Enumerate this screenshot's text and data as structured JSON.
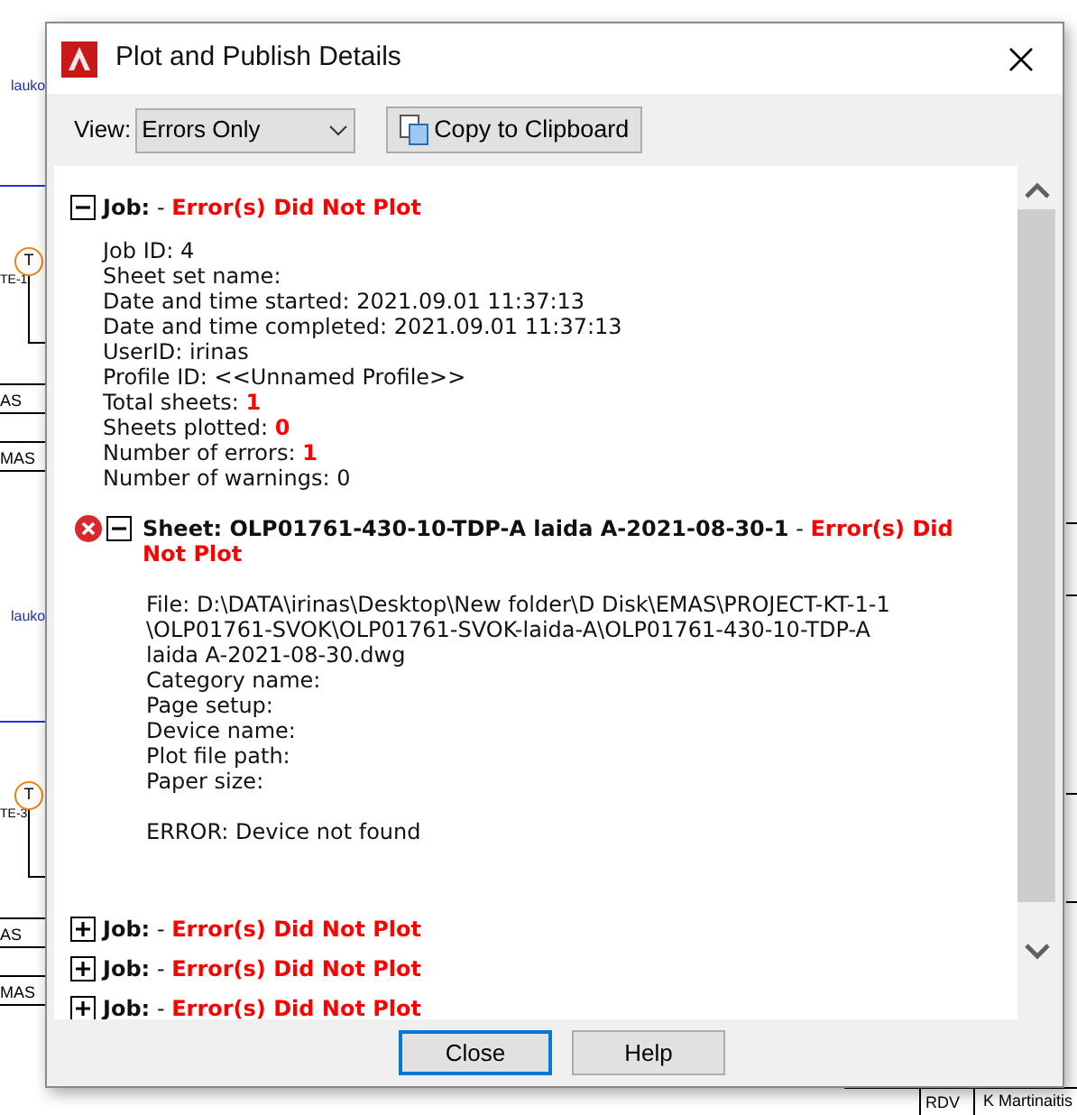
{
  "background": {
    "labels": [
      {
        "text": "lauko",
        "kind": "note"
      },
      {
        "text": "TE-1",
        "kind": "tag"
      },
      {
        "text": "T",
        "kind": "circle"
      },
      {
        "text": "AS",
        "kind": "cell"
      },
      {
        "text": "MAS",
        "kind": "cell"
      },
      {
        "text": "lauko",
        "kind": "note"
      },
      {
        "text": "TE-3",
        "kind": "tag"
      },
      {
        "text": "T",
        "kind": "circle"
      },
      {
        "text": "AS",
        "kind": "cell"
      },
      {
        "text": "MAS",
        "kind": "cell"
      },
      {
        "text": "RDV",
        "kind": "cell"
      },
      {
        "text": "K Martinaitis",
        "kind": "cell"
      }
    ]
  },
  "dialog": {
    "title": "Plot and Publish Details",
    "view": {
      "label": "View:",
      "value": "Errors Only"
    },
    "copy_button": "Copy to Clipboard",
    "jobs": [
      {
        "expanded": true,
        "label": "Job:",
        "separator": "-",
        "status": "Error(s) Did Not Plot",
        "details": [
          {
            "label": "Job ID:",
            "value": "4",
            "highlight": false
          },
          {
            "label": "Sheet set name:"
          },
          {
            "label": "Date and time started:",
            "value": "2021.09.01 11:37:13",
            "highlight": false
          },
          {
            "label": "Date and time completed:",
            "value": "2021.09.01 11:37:13",
            "highlight": false
          },
          {
            "label": "UserID:",
            "value": "irinas",
            "highlight": false
          },
          {
            "label": "Profile ID:",
            "value": "<<Unnamed Profile>>",
            "highlight": false
          },
          {
            "label": "Total sheets:",
            "value": "1",
            "highlight": true
          },
          {
            "label": "Sheets plotted:",
            "value": "0",
            "highlight": true
          },
          {
            "label": "Number of errors:",
            "value": "1",
            "highlight": true
          },
          {
            "label": "Number of warnings:",
            "value": "0",
            "highlight": false
          }
        ],
        "sheets": [
          {
            "expanded": true,
            "error": true,
            "label": "Sheet:",
            "name": "OLP01761-430-10-TDP-A laida A-2021-08-30-1",
            "separator": "-",
            "status": "Error(s) Did Not Plot",
            "lines": [
              "File: D:\\DATA\\irinas\\Desktop\\New folder\\D Disk\\EMAS\\PROJECT-KT-1-1",
              "\\OLP01761-SVOK\\OLP01761-SVOK-laida-A\\OLP01761-430-10-TDP-A",
              "laida A-2021-08-30.dwg",
              "Category name:",
              "Page setup:",
              "Device name:",
              "Plot file path:",
              "Paper size:"
            ],
            "message": "ERROR: Device not found"
          }
        ]
      },
      {
        "expanded": false,
        "label": "Job:",
        "separator": "-",
        "status": "Error(s) Did Not Plot"
      },
      {
        "expanded": false,
        "label": "Job:",
        "separator": "-",
        "status": "Error(s) Did Not Plot"
      },
      {
        "expanded": false,
        "label": "Job:",
        "separator": "-",
        "status": "Error(s) Did Not Plot"
      }
    ],
    "buttons": [
      {
        "label": "Close",
        "selected": true
      },
      {
        "label": "Help",
        "selected": false
      }
    ]
  }
}
